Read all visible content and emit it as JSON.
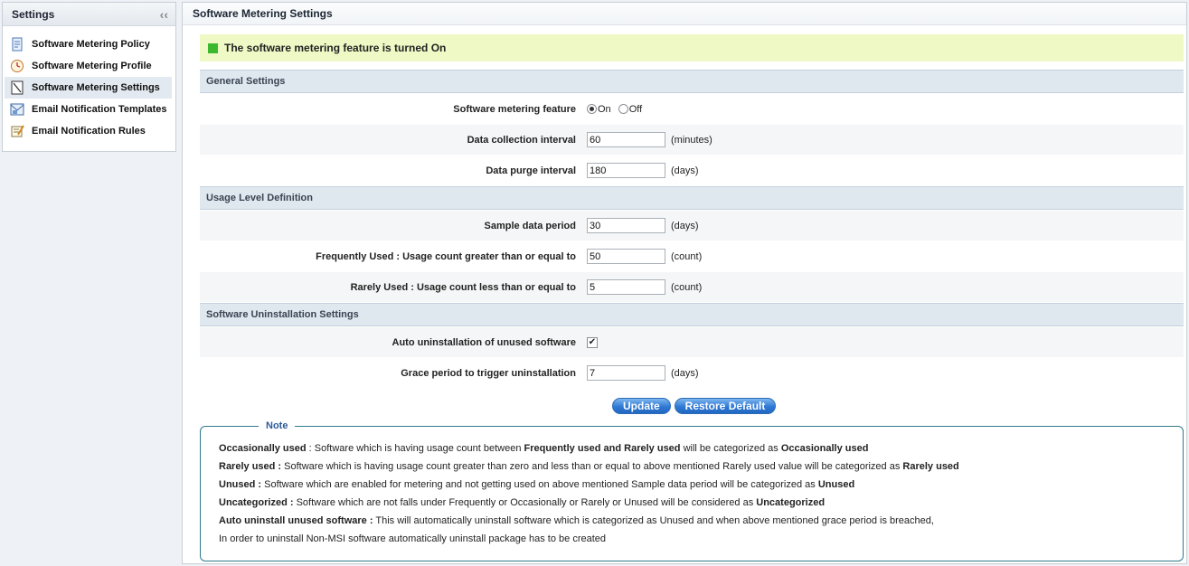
{
  "sidebar": {
    "title": "Settings",
    "items": [
      {
        "label": "Software Metering Policy",
        "icon": "policy-document-icon"
      },
      {
        "label": "Software Metering Profile",
        "icon": "profile-clock-icon"
      },
      {
        "label": "Software Metering Settings",
        "icon": "settings-document-icon"
      },
      {
        "label": "Email Notification Templates",
        "icon": "email-template-icon"
      },
      {
        "label": "Email Notification Rules",
        "icon": "email-rules-icon"
      }
    ],
    "active_index": 2
  },
  "main": {
    "title": "Software Metering Settings",
    "status_banner": "The software metering feature is turned On"
  },
  "general": {
    "header": "General Settings",
    "feature_label": "Software metering feature",
    "on_label": "On",
    "off_label": "Off",
    "selected": "On",
    "collection_label": "Data collection interval",
    "collection_value": "60",
    "collection_unit": "(minutes)",
    "purge_label": "Data purge interval",
    "purge_value": "180",
    "purge_unit": "(days)"
  },
  "usage": {
    "header": "Usage Level Definition",
    "sample_label": "Sample data period",
    "sample_value": "30",
    "sample_unit": "(days)",
    "frequent_label": "Frequently Used : Usage count greater than or equal to",
    "frequent_value": "50",
    "frequent_unit": "(count)",
    "rare_label": "Rarely Used : Usage count less than or equal to",
    "rare_value": "5",
    "rare_unit": "(count)"
  },
  "uninstall": {
    "header": "Software Uninstallation Settings",
    "auto_label": "Auto uninstallation of unused software",
    "auto_checked": true,
    "grace_label": "Grace period to trigger uninstallation",
    "grace_value": "7",
    "grace_unit": "(days)"
  },
  "buttons": {
    "update": "Update",
    "restore": "Restore Default"
  },
  "note": {
    "legend": "Note",
    "occ_term": "Occasionally used",
    "occ_text1": " : Software which is having usage count between ",
    "occ_bold1": "Frequently used and Rarely used",
    "occ_text2": " will be categorized as ",
    "occ_bold2": "Occasionally used",
    "rare_term": "Rarely used :",
    "rare_text": " Software which is having usage count greater than zero and less than or equal to above mentioned Rarely used value will be categorized as ",
    "rare_bold": "Rarely used",
    "unused_term": "Unused :",
    "unused_text": " Software which are enabled for metering and not getting used on above mentioned Sample data period will be categorized as ",
    "unused_bold": "Unused",
    "uncat_term": "Uncategorized :",
    "uncat_text": " Software which are not falls under Frequently or Occasionally or Rarely or Unused will be considered as ",
    "uncat_bold": "Uncategorized",
    "auto_term": "Auto uninstall unused software :",
    "auto_text": " This will automatically uninstall software which is categorized as Unused and when above mentioned grace period is breached,",
    "nonmsi_text": "In order to uninstall Non-MSI software automatically uninstall package has to be created"
  },
  "colors": {
    "status_on": "#3cb82e",
    "banner_bg": "#eef9c5",
    "button": "#2f79d4"
  }
}
